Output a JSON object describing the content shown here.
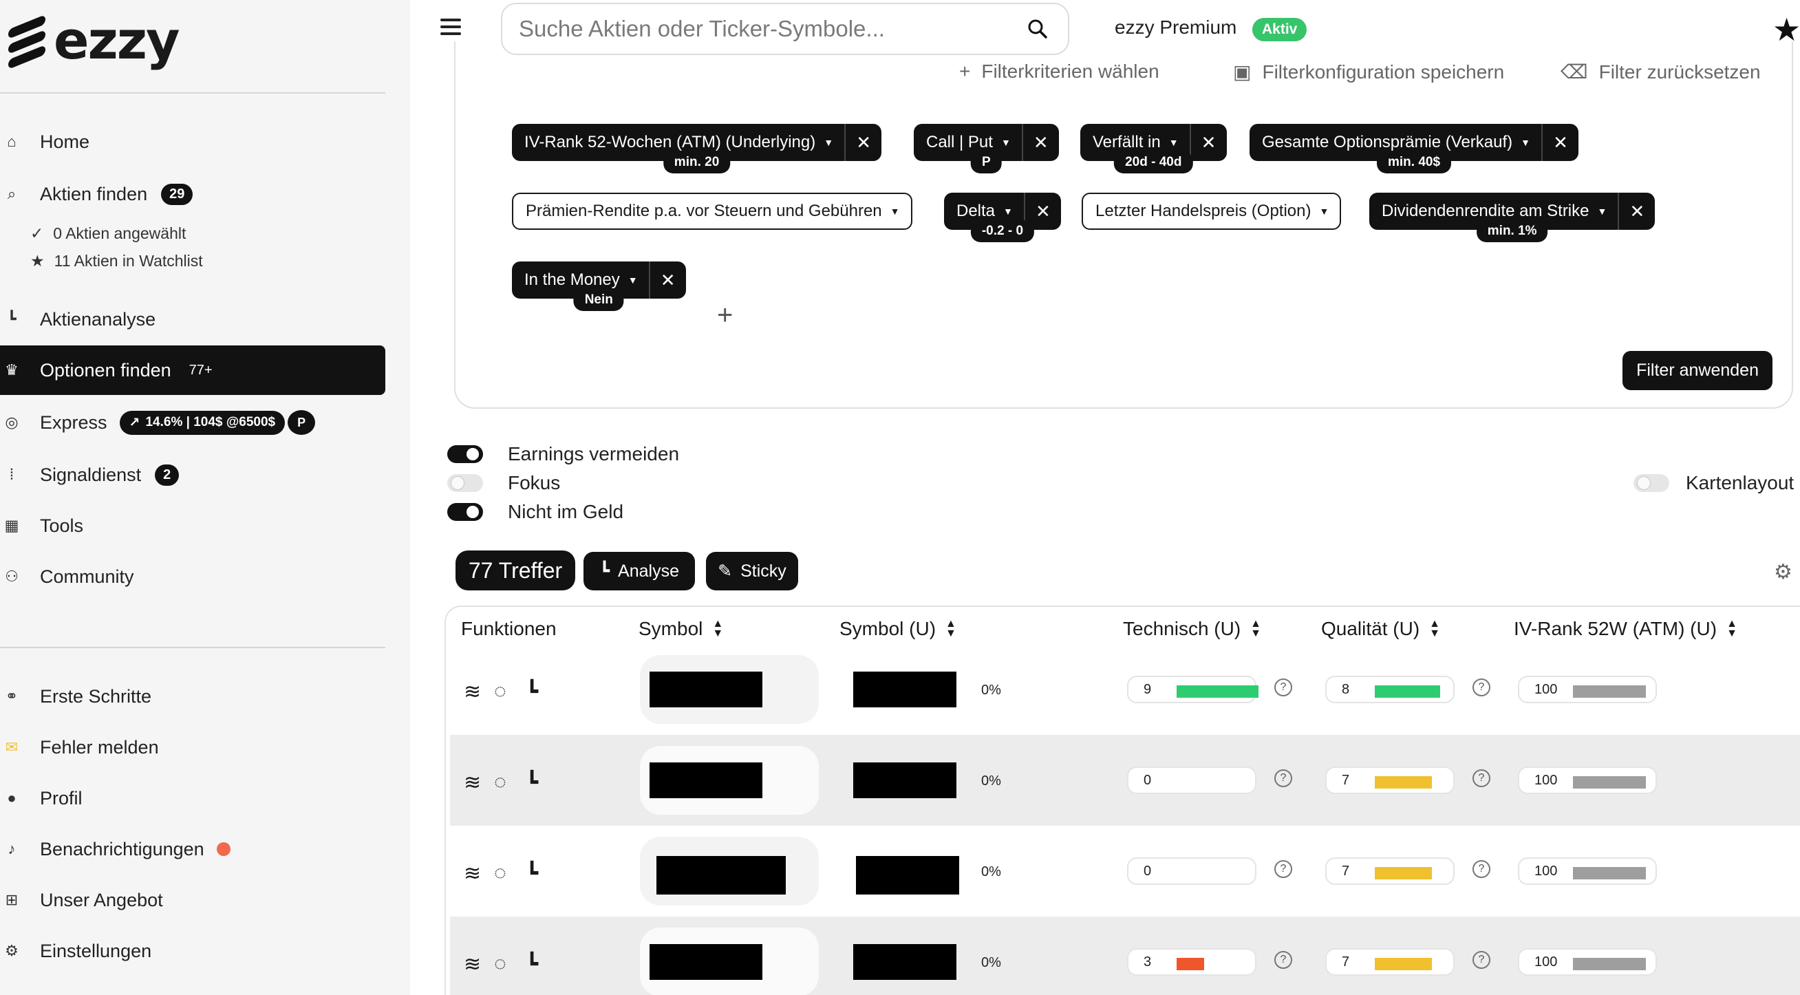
{
  "brand": {
    "name": "ezzy"
  },
  "sidebar": {
    "nav": [
      {
        "label": "Home",
        "icon": "home-icon"
      },
      {
        "label": "Aktien finden",
        "icon": "search-icon",
        "badge": "29"
      },
      {
        "label": "Aktienanalyse",
        "icon": "chart-icon"
      },
      {
        "label": "Optionen finden",
        "icon": "trophy-icon",
        "badge": "77+"
      },
      {
        "label": "Express",
        "icon": "coins-icon",
        "pill": "14.6% | 104$ @6500$",
        "pill_extra": "P"
      },
      {
        "label": "Signaldienst",
        "icon": "antenna-icon",
        "badge": "2"
      },
      {
        "label": "Tools",
        "icon": "calculator-icon"
      },
      {
        "label": "Community",
        "icon": "users-icon"
      }
    ],
    "sub": [
      {
        "label": "0 Aktien angewählt",
        "icon": "check-icon"
      },
      {
        "label": "11 Aktien in Watchlist",
        "icon": "star-icon"
      }
    ],
    "bottom": [
      {
        "label": "Erste Schritte",
        "icon": "handshake-icon"
      },
      {
        "label": "Fehler melden",
        "icon": "mail-icon"
      },
      {
        "label": "Profil",
        "icon": "user-icon"
      },
      {
        "label": "Benachrichtigungen",
        "icon": "bell-icon"
      },
      {
        "label": "Unser Angebot",
        "icon": "gift-icon"
      },
      {
        "label": "Einstellungen",
        "icon": "gears-icon"
      }
    ]
  },
  "topbar": {
    "search_placeholder": "Suche Aktien oder Ticker-Symbole...",
    "premium_label": "ezzy Premium",
    "premium_status": "Aktiv"
  },
  "filter_panel": {
    "actions": [
      {
        "label": "Filterkriterien wählen",
        "icon": "plus-icon"
      },
      {
        "label": "Filterkonfiguration speichern",
        "icon": "save-icon"
      },
      {
        "label": "Filter zurücksetzen",
        "icon": "eraser-icon"
      }
    ],
    "chips": [
      {
        "label": "IV-Rank 52-Wochen (ATM) (Underlying)",
        "value": "min. 20",
        "style": "dark"
      },
      {
        "label": "Call | Put",
        "value": "P",
        "style": "dark"
      },
      {
        "label": "Verfällt in",
        "value": "20d - 40d",
        "style": "dark"
      },
      {
        "label": "Gesamte Optionsprämie (Verkauf)",
        "value": "min. 40$",
        "style": "dark"
      },
      {
        "label": "Prämien-Rendite p.a. vor Steuern und Gebühren",
        "value": "",
        "style": "light"
      },
      {
        "label": "Delta",
        "value": "-0.2 - 0",
        "style": "dark"
      },
      {
        "label": "Letzter Handelspreis (Option)",
        "value": "",
        "style": "light"
      },
      {
        "label": "Dividendenrendite am Strike",
        "value": "min. 1%",
        "style": "dark"
      },
      {
        "label": "In the Money",
        "value": "Nein",
        "style": "dark"
      }
    ],
    "apply_label": "Filter anwenden"
  },
  "toggles": [
    {
      "label": "Earnings vermeiden",
      "on": true
    },
    {
      "label": "Fokus",
      "on": false
    },
    {
      "label": "Nicht im Geld",
      "on": true
    },
    {
      "label": "Kartenlayout",
      "on": false
    }
  ],
  "results": {
    "count_label": "77 Treffer",
    "analyse_label": "Analyse",
    "sticky_label": "Sticky"
  },
  "table": {
    "columns": [
      "Funktionen",
      "Symbol",
      "Symbol (U)",
      "Technisch (U)",
      "Qualität (U)",
      "IV-Rank 52W (ATM) (U)"
    ],
    "rows": [
      {
        "pct": "0%",
        "technisch": "9",
        "technisch_level": 0.9,
        "technisch_color": "#2ecc71",
        "qualitaet": "8",
        "qualitaet_level": 0.8,
        "qualitaet_color": "#2ecc71",
        "ivrank": "100",
        "ivrank_color": "#9e9e9e"
      },
      {
        "pct": "0%",
        "technisch": "0",
        "technisch_level": 0,
        "technisch_color": "#2ecc71",
        "qualitaet": "7",
        "qualitaet_level": 0.7,
        "qualitaet_color": "#f0c02f",
        "ivrank": "100",
        "ivrank_color": "#9e9e9e"
      },
      {
        "pct": "0%",
        "technisch": "0",
        "technisch_level": 0,
        "technisch_color": "#2ecc71",
        "qualitaet": "7",
        "qualitaet_level": 0.7,
        "qualitaet_color": "#f0c02f",
        "ivrank": "100",
        "ivrank_color": "#9e9e9e"
      },
      {
        "pct": "0%",
        "technisch": "3",
        "technisch_level": 0.3,
        "technisch_color": "#f0562b",
        "qualitaet": "7",
        "qualitaet_level": 0.7,
        "qualitaet_color": "#f0c02f",
        "ivrank": "100",
        "ivrank_color": "#9e9e9e"
      }
    ]
  }
}
